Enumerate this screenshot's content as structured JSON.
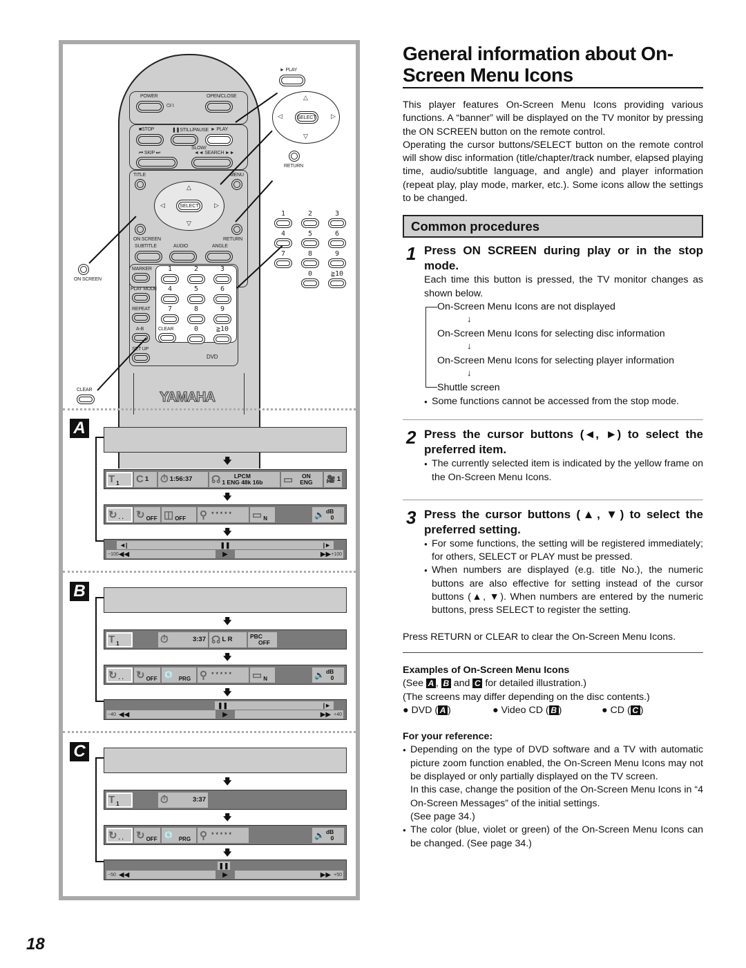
{
  "page": {
    "number": "18",
    "title": "General information about On-Screen Menu Icons",
    "title_line1": "General information about On-",
    "title_line2": "Screen Menu Icons",
    "intro": "This player features On-Screen Menu Icons providing various functions. A “banner” will be displayed on the TV monitor by pressing the ON SCREEN button on the remote control.",
    "intro2": "Operating the cursor buttons/SELECT button on the remote control will show disc information (title/chapter/track number, elapsed playing time, audio/subtitle language, and angle) and player information (repeat play, play mode, marker, etc.). Some icons allow the settings to be changed."
  },
  "common_procedures": {
    "header": "Common procedures",
    "steps": [
      {
        "num": "1",
        "title": "Press ON SCREEN during play or in the stop mode.",
        "text": "Each time this button is pressed, the TV monitor changes as shown below.",
        "flow": [
          "On-Screen Menu Icons are not displayed",
          "On-Screen Menu Icons for selecting disc information",
          "On-Screen Menu Icons for selecting player information",
          "Shuttle screen"
        ],
        "bullets": [
          "Some functions cannot be accessed from the stop mode."
        ]
      },
      {
        "num": "2",
        "title": "Press the cursor buttons (◄, ►) to select the preferred item.",
        "bullets": [
          "The currently selected item is indicated by the yellow frame on the On-Screen Menu Icons."
        ]
      },
      {
        "num": "3",
        "title": "Press the cursor buttons (▲, ▼) to select the preferred setting.",
        "bullets": [
          "For some functions, the setting will be registered immediately; for others, SELECT or PLAY must be pressed.",
          "When numbers are displayed (e.g. title No.), the numeric buttons are also effective for setting instead of the cursor buttons (▲, ▼). When numbers are entered by the numeric buttons, press SELECT to register the setting."
        ]
      }
    ],
    "clear_note": "Press RETURN or CLEAR to clear the On-Screen Menu Icons."
  },
  "examples": {
    "heading": "Examples of On-Screen Menu Icons",
    "see_prefix": "(See ",
    "see_and": " and ",
    "see_suffix": " for detailed illustration.)",
    "differ": "(The screens may differ depending on the disc contents.)",
    "items": [
      {
        "label": "DVD (",
        "chip": "A",
        "close": ")"
      },
      {
        "label": "Video CD (",
        "chip": "B",
        "close": ")"
      },
      {
        "label": "CD (",
        "chip": "C",
        "close": ")"
      }
    ]
  },
  "reference": {
    "heading": "For your reference:",
    "bullet1": "Depending on the type of DVD software and a TV with automatic picture zoom function enabled, the On-Screen Menu Icons may not be displayed or only partially displayed on the TV screen.",
    "bullet1_cont": "In this case, change the position of the On-Screen Menu Icons in “4 On-Screen Messages” of the initial settings.",
    "bullet1_see": "(See page 34.)",
    "bullet2": "The color (blue, violet or green) of the On-Screen Menu Icons can be changed. (See page 34.)"
  },
  "remote": {
    "brand": "YAMAHA",
    "labels": {
      "power": "POWER",
      "power_sym": "⏻/ I",
      "open_close": "OPEN/CLOSE",
      "stop": "■STOP",
      "still_pause": "❚❚STILL/PAUSE",
      "play": "► PLAY",
      "slow_search": "SLOW/",
      "skip": "⏮  SKIP  ⏭",
      "search": "◄◄ SEARCH ►►",
      "title": "TITLE",
      "menu": "MENU",
      "select": "SELECT",
      "on_screen": "ON SCREEN",
      "return": "RETURN",
      "subtitle": "SUBTITLE",
      "audio": "AUDIO",
      "angle": "ANGLE",
      "marker": "MARKER",
      "play_mode": "PLAY MODE",
      "repeat": "REPEAT",
      "ab": "A-B",
      "clear": "CLEAR",
      "setup": "SET UP",
      "dvd": "DVD"
    },
    "numbers": [
      "1",
      "2",
      "3",
      "4",
      "5",
      "6",
      "7",
      "8",
      "9",
      "0",
      "≧10"
    ],
    "callouts": {
      "play": "► PLAY",
      "select": "SELECT",
      "return": "RETURN",
      "on_screen": "ON SCREEN",
      "clear": "CLEAR"
    }
  },
  "screens": {
    "A": {
      "label": "A",
      "disc": {
        "title": "1",
        "chapter": "1",
        "time": "1:56:37",
        "audio_top": "LPCM",
        "audio_bottom": "1 ENG 48k 16b",
        "subtitle_top": "ON",
        "subtitle_bottom": "ENG",
        "angle": "1"
      },
      "player": {
        "repeat1": "· ·",
        "repeat2": "OFF",
        "surround": "OFF",
        "marker": "* * * * *",
        "picture": "N",
        "db_label": "dB",
        "db_value": "0"
      },
      "shuttle": {
        "left": "−100",
        "right": "+100"
      }
    },
    "B": {
      "label": "B",
      "disc": {
        "title": "1",
        "time": "3:37",
        "audio": "L  R",
        "pbc_top": "PBC",
        "pbc_bottom": "OFF"
      },
      "player": {
        "repeat1": "· ·",
        "repeat2": "OFF",
        "mode": "PRG",
        "marker": "* * * * *",
        "picture": "N",
        "db_label": "dB",
        "db_value": "0"
      },
      "shuttle": {
        "left": "−40",
        "right": "+40"
      }
    },
    "C": {
      "label": "C",
      "disc": {
        "title": "1",
        "time": "3:37"
      },
      "player": {
        "repeat1": "· ·",
        "repeat2": "OFF",
        "mode": "PRG",
        "marker": "* * * * *",
        "db_label": "dB",
        "db_value": "0"
      },
      "shuttle": {
        "left": "−50",
        "right": "+50"
      }
    }
  }
}
